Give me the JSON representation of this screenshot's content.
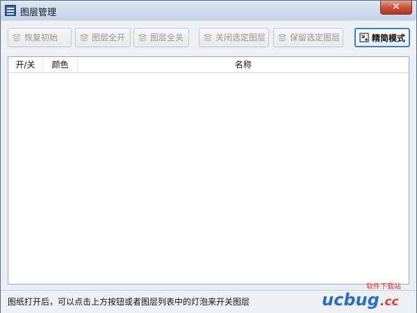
{
  "window": {
    "title": "图层管理",
    "close_glyph": "✕"
  },
  "toolbar": {
    "buttons": [
      {
        "label": "恢复初始",
        "icon": "layers-restore-icon",
        "enabled": false
      },
      {
        "label": "图层全开",
        "icon": "layers-open-icon",
        "enabled": false
      },
      {
        "label": "图层全关",
        "icon": "layers-close-icon",
        "enabled": false
      },
      {
        "label": "关闭选定图层",
        "icon": "layers-close-selected-icon",
        "enabled": false
      },
      {
        "label": "保留选定图层",
        "icon": "layers-keep-selected-icon",
        "enabled": false
      },
      {
        "label": "精简模式",
        "icon": "simple-mode-icon",
        "enabled": true
      }
    ]
  },
  "layer_table": {
    "columns": [
      "开/关",
      "颜色",
      "名称"
    ],
    "rows": []
  },
  "status": {
    "text": "图纸打开后，可以点击上方按钮或者图层列表中的灯泡来开关图层"
  },
  "watermark": {
    "brand": "ucbug.cc",
    "tagline": "软件下载站"
  },
  "colors": {
    "accent": "#3c7fc4",
    "close": "#c84f35",
    "disabled_text": "#8f959c"
  }
}
